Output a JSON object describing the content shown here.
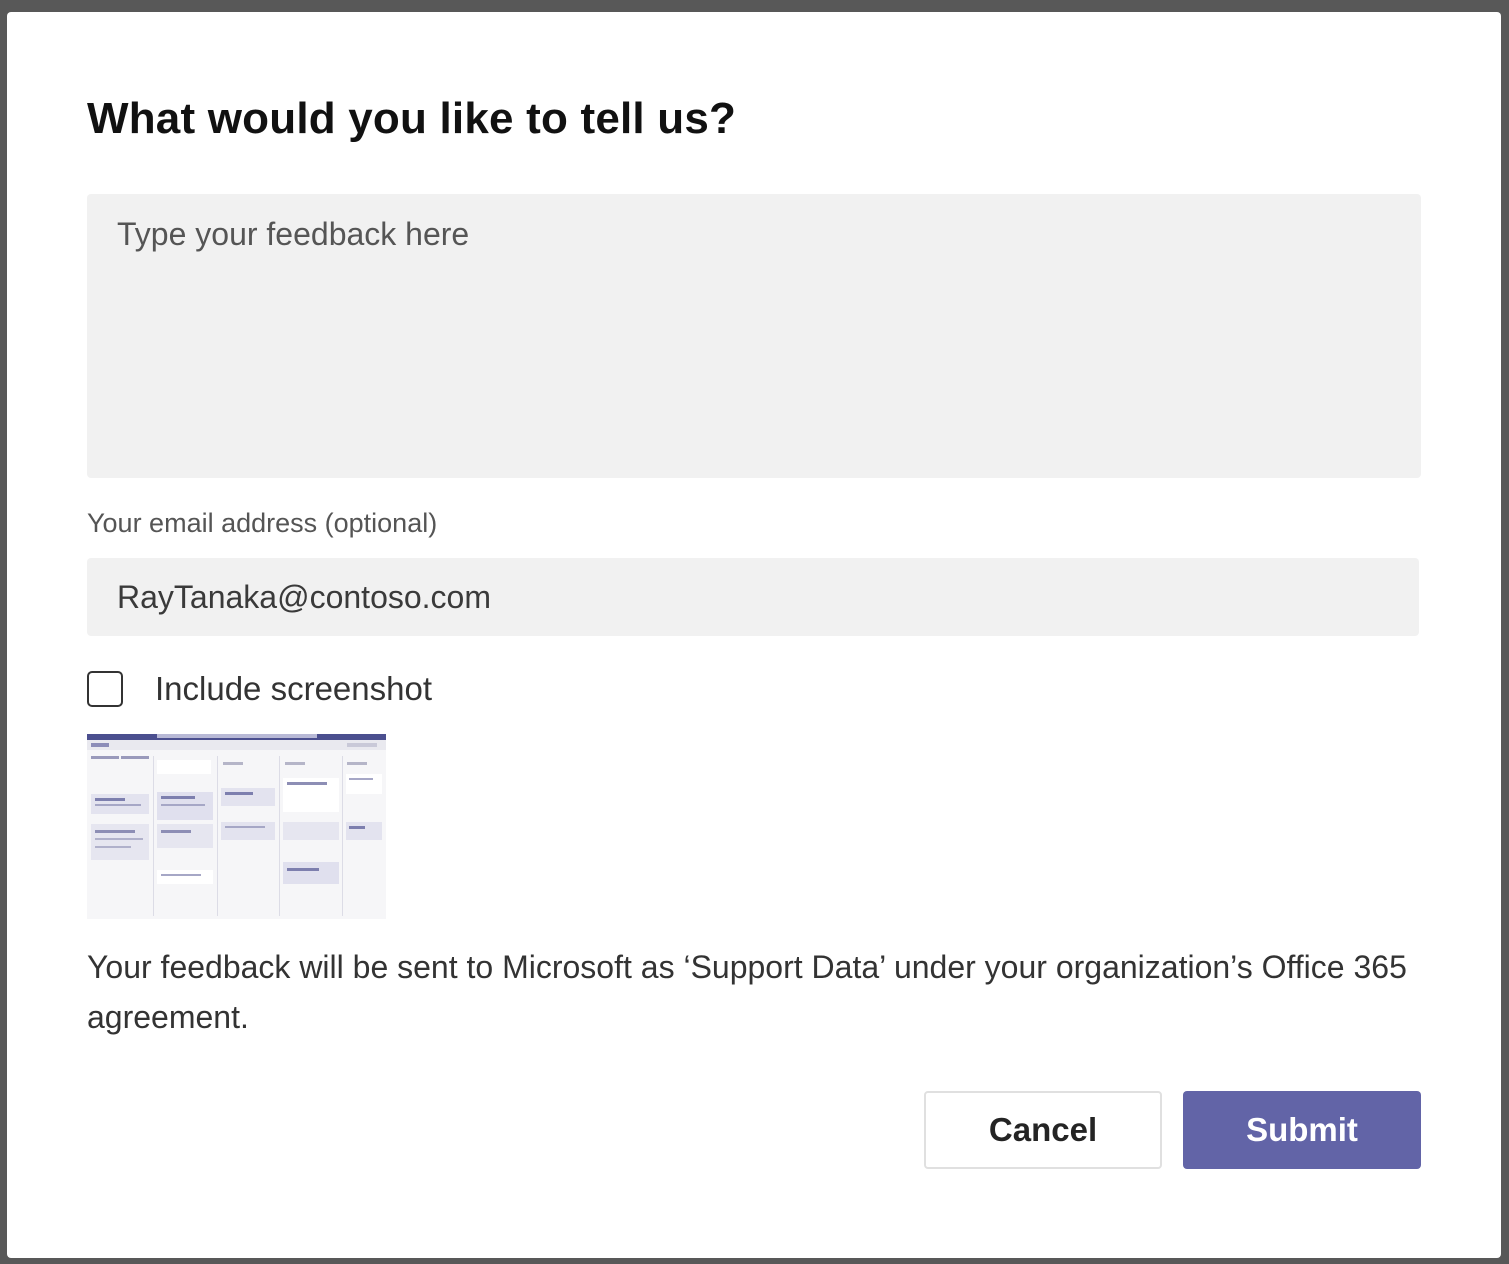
{
  "dialog": {
    "title": "What would you like to tell us?",
    "feedback": {
      "placeholder": "Type your feedback here",
      "value": ""
    },
    "email": {
      "label": "Your email address (optional)",
      "value": "RayTanaka@contoso.com"
    },
    "screenshot": {
      "label": "Include screenshot",
      "checked": false,
      "thumbnail_icon": "screenshot-thumbnail"
    },
    "notice": "Your feedback will be sent to Microsoft as ‘Support Data’ under your organization’s Office 365 agreement.",
    "buttons": {
      "cancel_label": "Cancel",
      "submit_label": "Submit"
    }
  },
  "colors": {
    "accent": "#6264a7",
    "field_background": "#f1f1f1",
    "overlay": "#585858"
  }
}
